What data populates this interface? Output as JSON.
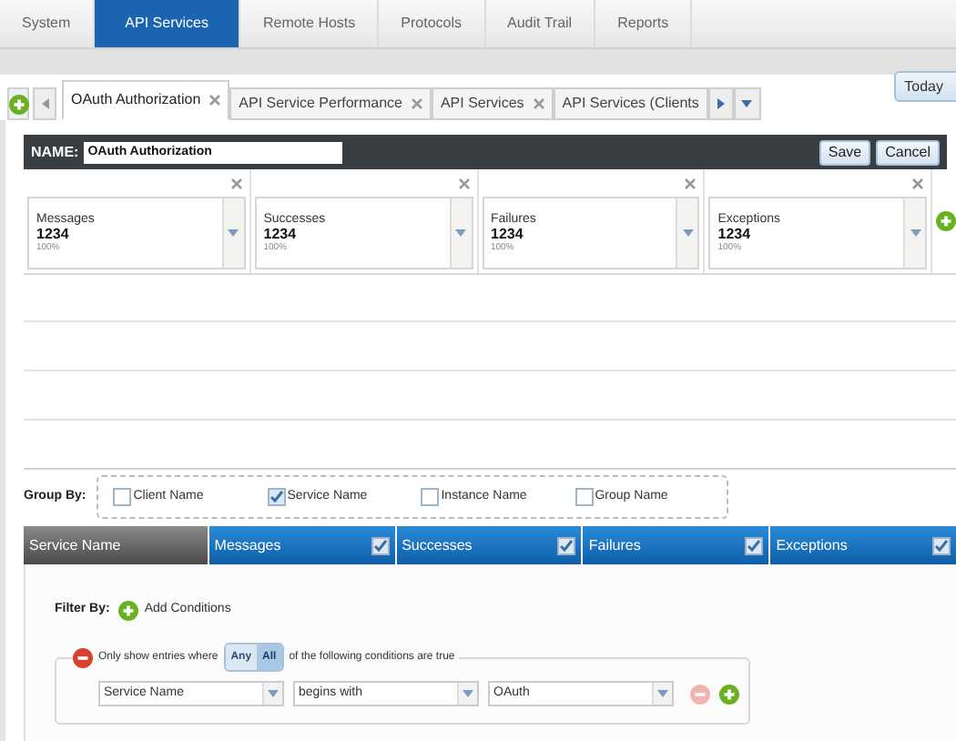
{
  "top_nav": [
    {
      "label": "System",
      "selected": false
    },
    {
      "label": "API Services",
      "selected": true
    },
    {
      "label": "Remote Hosts",
      "selected": false
    },
    {
      "label": "Protocols",
      "selected": false
    },
    {
      "label": "Audit Trail",
      "selected": false
    },
    {
      "label": "Reports",
      "selected": false
    }
  ],
  "dashboard_tabs": [
    {
      "label": "OAuth Authorization",
      "selected": true,
      "closable": true
    },
    {
      "label": "API Service Performance",
      "selected": false,
      "closable": true
    },
    {
      "label": "API Services",
      "selected": false,
      "closable": true
    },
    {
      "label": "API Services (Clients",
      "selected": false,
      "closable": false
    }
  ],
  "date_range": {
    "value": "Today"
  },
  "name_bar": {
    "label": "NAME:",
    "value": "OAuth Authorization",
    "buttons": [
      "Save",
      "Cancel"
    ]
  },
  "metrics": [
    {
      "name": "Messages",
      "value": "1234",
      "percent": "100%"
    },
    {
      "name": "Successes",
      "value": "1234",
      "percent": "100%"
    },
    {
      "name": "Failures",
      "value": "1234",
      "percent": "100%"
    },
    {
      "name": "Exceptions",
      "value": "1234",
      "percent": "100%"
    }
  ],
  "group_by": {
    "label": "Group By:",
    "options": [
      {
        "label": "Client Name",
        "checked": false
      },
      {
        "label": "Service Name",
        "checked": true
      },
      {
        "label": "Instance Name",
        "checked": false
      },
      {
        "label": "Group Name",
        "checked": false
      }
    ]
  },
  "table": {
    "columns": [
      {
        "label": "Service Name",
        "kind": "label"
      },
      {
        "label": "Messages",
        "kind": "checkable",
        "checked": true
      },
      {
        "label": "Successes",
        "kind": "checkable",
        "checked": true
      },
      {
        "label": "Failures",
        "kind": "checkable",
        "checked": true
      },
      {
        "label": "Exceptions",
        "kind": "checkable",
        "checked": true
      }
    ]
  },
  "filter": {
    "label": "Filter By:",
    "add_label": "Add Conditions",
    "intro": "Only show entries where",
    "modes": [
      {
        "label": "Any",
        "selected": false
      },
      {
        "label": "All",
        "selected": true
      }
    ],
    "outro": "of the following conditions are true",
    "conditions": [
      {
        "field": "Service Name",
        "operator": "begins with",
        "value": "OAuth"
      }
    ]
  }
}
